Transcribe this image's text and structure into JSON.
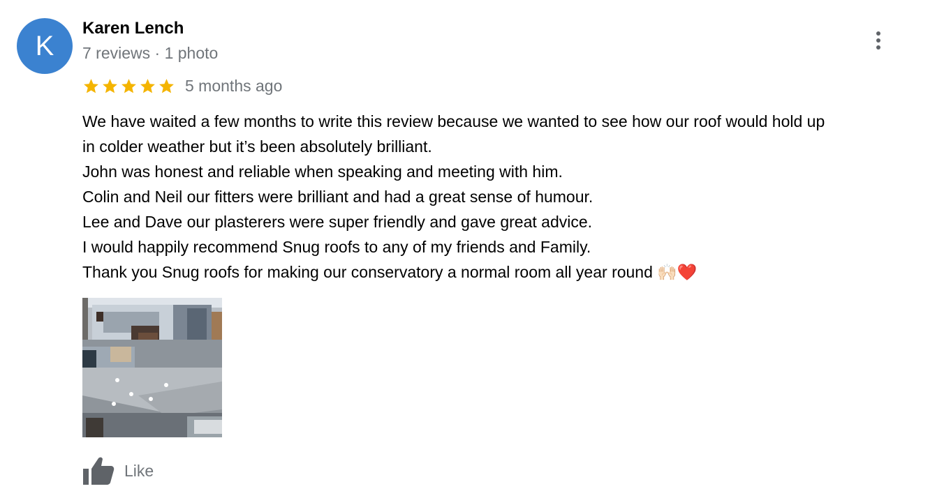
{
  "reviewer": {
    "initial": "K",
    "name": "Karen Lench",
    "meta": "7 reviews · 1 photo",
    "avatar_color": "#3b82d0"
  },
  "rating": {
    "stars": 5,
    "star_color": "#f4b400",
    "time_ago": "5 months ago"
  },
  "review_lines": [
    "We have waited a few months to write this review because we wanted to see how our roof would hold up",
    "in colder weather but it’s been absolutely brilliant.",
    "John was honest and reliable when speaking and meeting with him.",
    "Colin and Neil our fitters were brilliant and had a great sense of humour.",
    "Lee and Dave our plasterers were super friendly and gave great advice.",
    "I would happily recommend Snug roofs to any of my friends and Family.",
    "Thank you Snug roofs for making our conservatory a normal room all year round 🙌🏻❤️"
  ],
  "icons": {
    "menu": "more-vert-icon",
    "star": "star-icon",
    "like": "thumbs-up-icon"
  },
  "actions": {
    "like_label": "Like"
  }
}
